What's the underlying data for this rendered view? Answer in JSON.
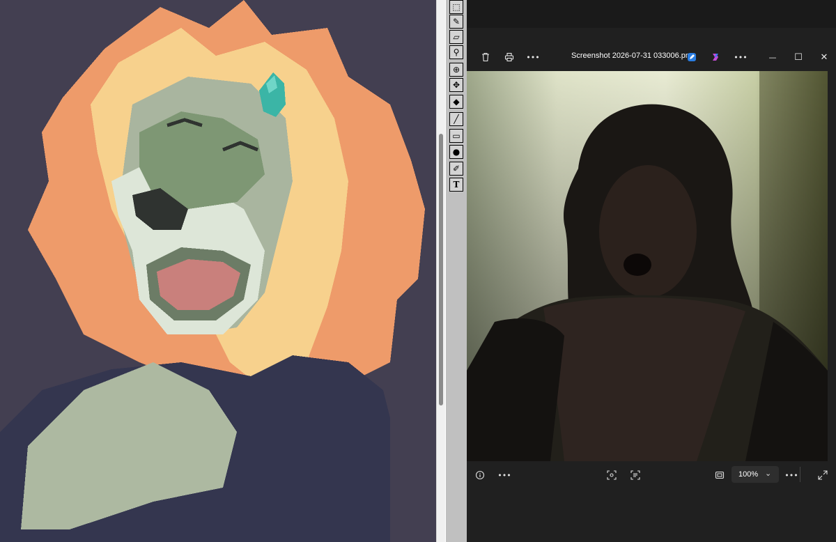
{
  "canvas": {
    "background_color": "#433f51",
    "artwork": "pixel-art lion character with closed eyes and open mouth, orange-yellow mane, teal gem"
  },
  "toolbox": {
    "tools": [
      {
        "name": "select-rectangle",
        "glyph": "⬚"
      },
      {
        "name": "pencil",
        "glyph": "✎"
      },
      {
        "name": "eraser",
        "glyph": "▱"
      },
      {
        "name": "eyedropper",
        "glyph": "⚲"
      },
      {
        "name": "zoom",
        "glyph": "⊕"
      },
      {
        "name": "move",
        "glyph": "✥"
      },
      {
        "name": "fill",
        "glyph": "◆"
      },
      {
        "name": "line",
        "glyph": "╱"
      },
      {
        "name": "rectangle",
        "glyph": "▭"
      },
      {
        "name": "ellipse",
        "glyph": "●"
      },
      {
        "name": "brush",
        "glyph": "✐"
      },
      {
        "name": "text",
        "glyph": "T"
      }
    ]
  },
  "photos": {
    "title": "Screenshot 2026-07-31 033006.png",
    "toolbar": {
      "delete_icon": "trash-icon",
      "print_icon": "printer-icon",
      "more_label": "•••",
      "edit_icon": "edit-icon",
      "copilot_icon": "copilot-icon",
      "minimize_glyph": "—",
      "maximize_glyph": "☐",
      "close_glyph": "✕"
    },
    "bottom": {
      "info_icon": "info-icon",
      "more_label": "•••",
      "zoom_value": "100%",
      "zoom_chevron": "⌄",
      "more2_label": "•••"
    },
    "colors": {
      "window_bg": "#202020",
      "accent": "#4c8bf5"
    }
  }
}
